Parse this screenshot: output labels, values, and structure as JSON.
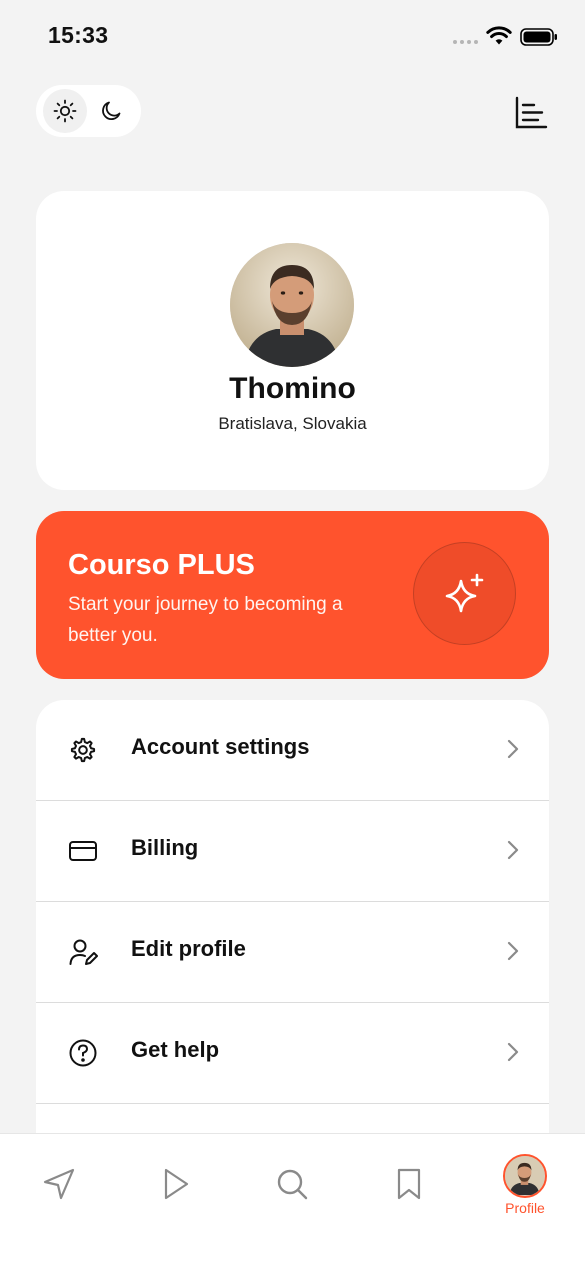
{
  "status_bar": {
    "time": "15:33"
  },
  "theme_toggle": {
    "light_icon": "sun-icon",
    "dark_icon": "moon-icon",
    "selected": "light"
  },
  "header": {
    "stats_icon": "bar-chart-icon"
  },
  "profile": {
    "name": "Thomino",
    "location": "Bratislava, Slovakia"
  },
  "plus_banner": {
    "title": "Courso PLUS",
    "subtitle": "Start your journey to becoming a better you.",
    "icon": "sparkles-icon",
    "color": "#ff532d"
  },
  "menu": {
    "items": [
      {
        "label": "Account settings",
        "icon": "gear-icon"
      },
      {
        "label": "Billing",
        "icon": "credit-card-icon"
      },
      {
        "label": "Edit profile",
        "icon": "user-edit-icon"
      },
      {
        "label": "Get help",
        "icon": "help-circle-icon"
      }
    ]
  },
  "tab_bar": {
    "tabs": [
      {
        "icon": "navigation-icon"
      },
      {
        "icon": "play-icon"
      },
      {
        "icon": "search-icon"
      },
      {
        "icon": "bookmark-icon"
      },
      {
        "icon": "avatar",
        "label": "Profile",
        "active": true
      }
    ],
    "active_color": "#ff532d"
  }
}
